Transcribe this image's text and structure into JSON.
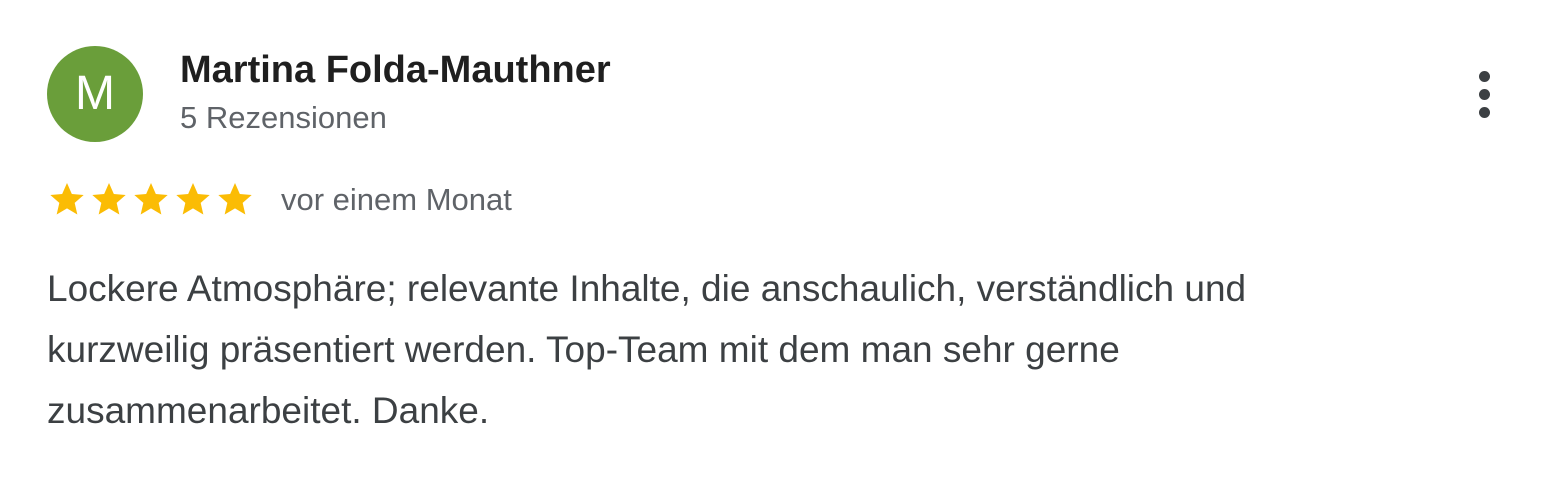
{
  "review": {
    "author": {
      "initial": "M",
      "name": "Martina Folda-Mauthner",
      "review_count": "5 Rezensionen",
      "avatar_color": "#6a9e3a"
    },
    "rating": {
      "stars": 5,
      "max_stars": 5,
      "star_color": "#fbbc04",
      "empty_star_color": "#dadce0"
    },
    "date": "vor einem Monat",
    "text_lines": [
      "Lockere Atmosphäre; relevante Inhalte, die anschaulich, verständlich und",
      "kurzweilig präsentiert werden. Top-Team mit dem man sehr gerne",
      "zusammenarbeitet. Danke."
    ],
    "menu_icon": "more-vert-icon"
  }
}
